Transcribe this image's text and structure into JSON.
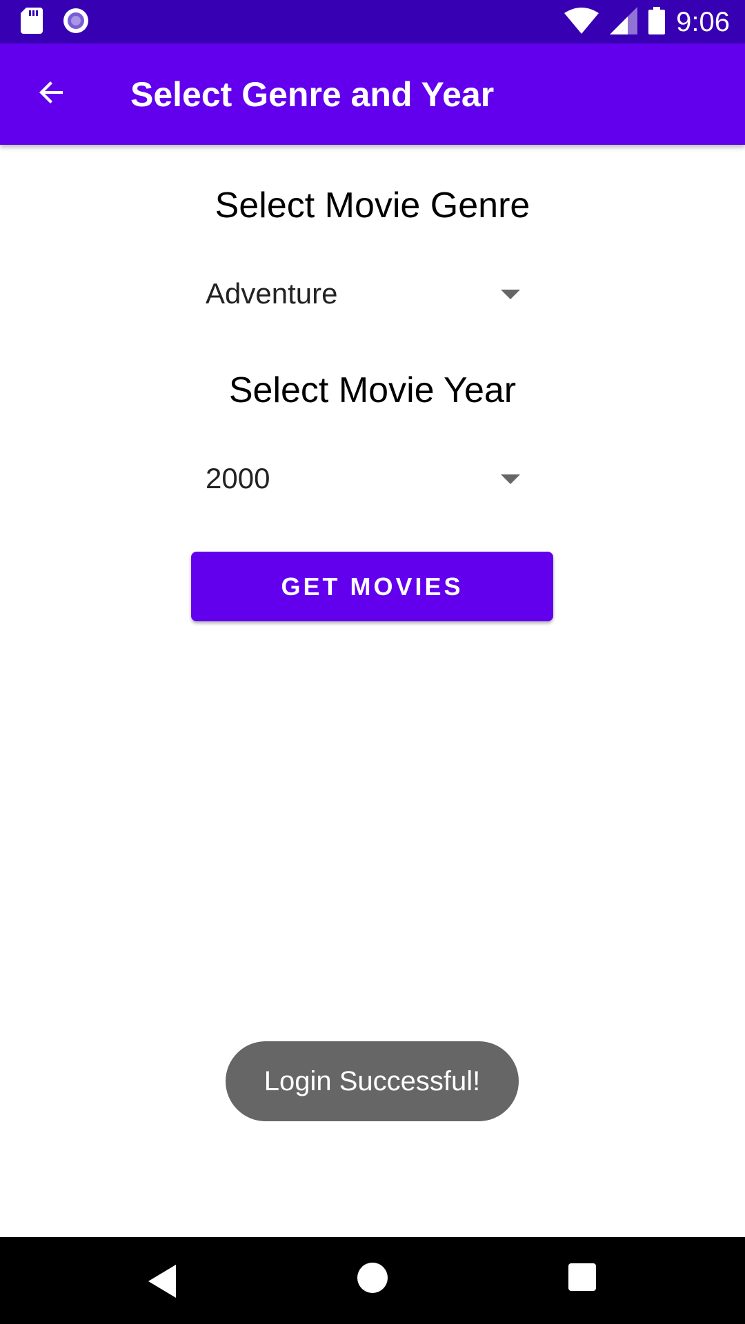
{
  "status_bar": {
    "time": "9:06",
    "icons": [
      "sd-card-icon",
      "record-icon",
      "wifi-icon",
      "signal-icon",
      "battery-icon"
    ]
  },
  "app_bar": {
    "title": "Select Genre and Year",
    "back_icon": "arrow-back-icon"
  },
  "genre_section": {
    "heading": "Select Movie Genre",
    "selected": "Adventure"
  },
  "year_section": {
    "heading": "Select Movie Year",
    "selected": "2000"
  },
  "get_movies_button": {
    "label": "GET MOVIES"
  },
  "toast": {
    "message": "Login Successful!"
  },
  "colors": {
    "status_bar": "#3700b3",
    "primary": "#6200ee",
    "toast": "#666666",
    "nav_bar": "#000000"
  },
  "nav_bar": {
    "icons": [
      "nav-back-icon",
      "nav-home-icon",
      "nav-recents-icon"
    ]
  }
}
